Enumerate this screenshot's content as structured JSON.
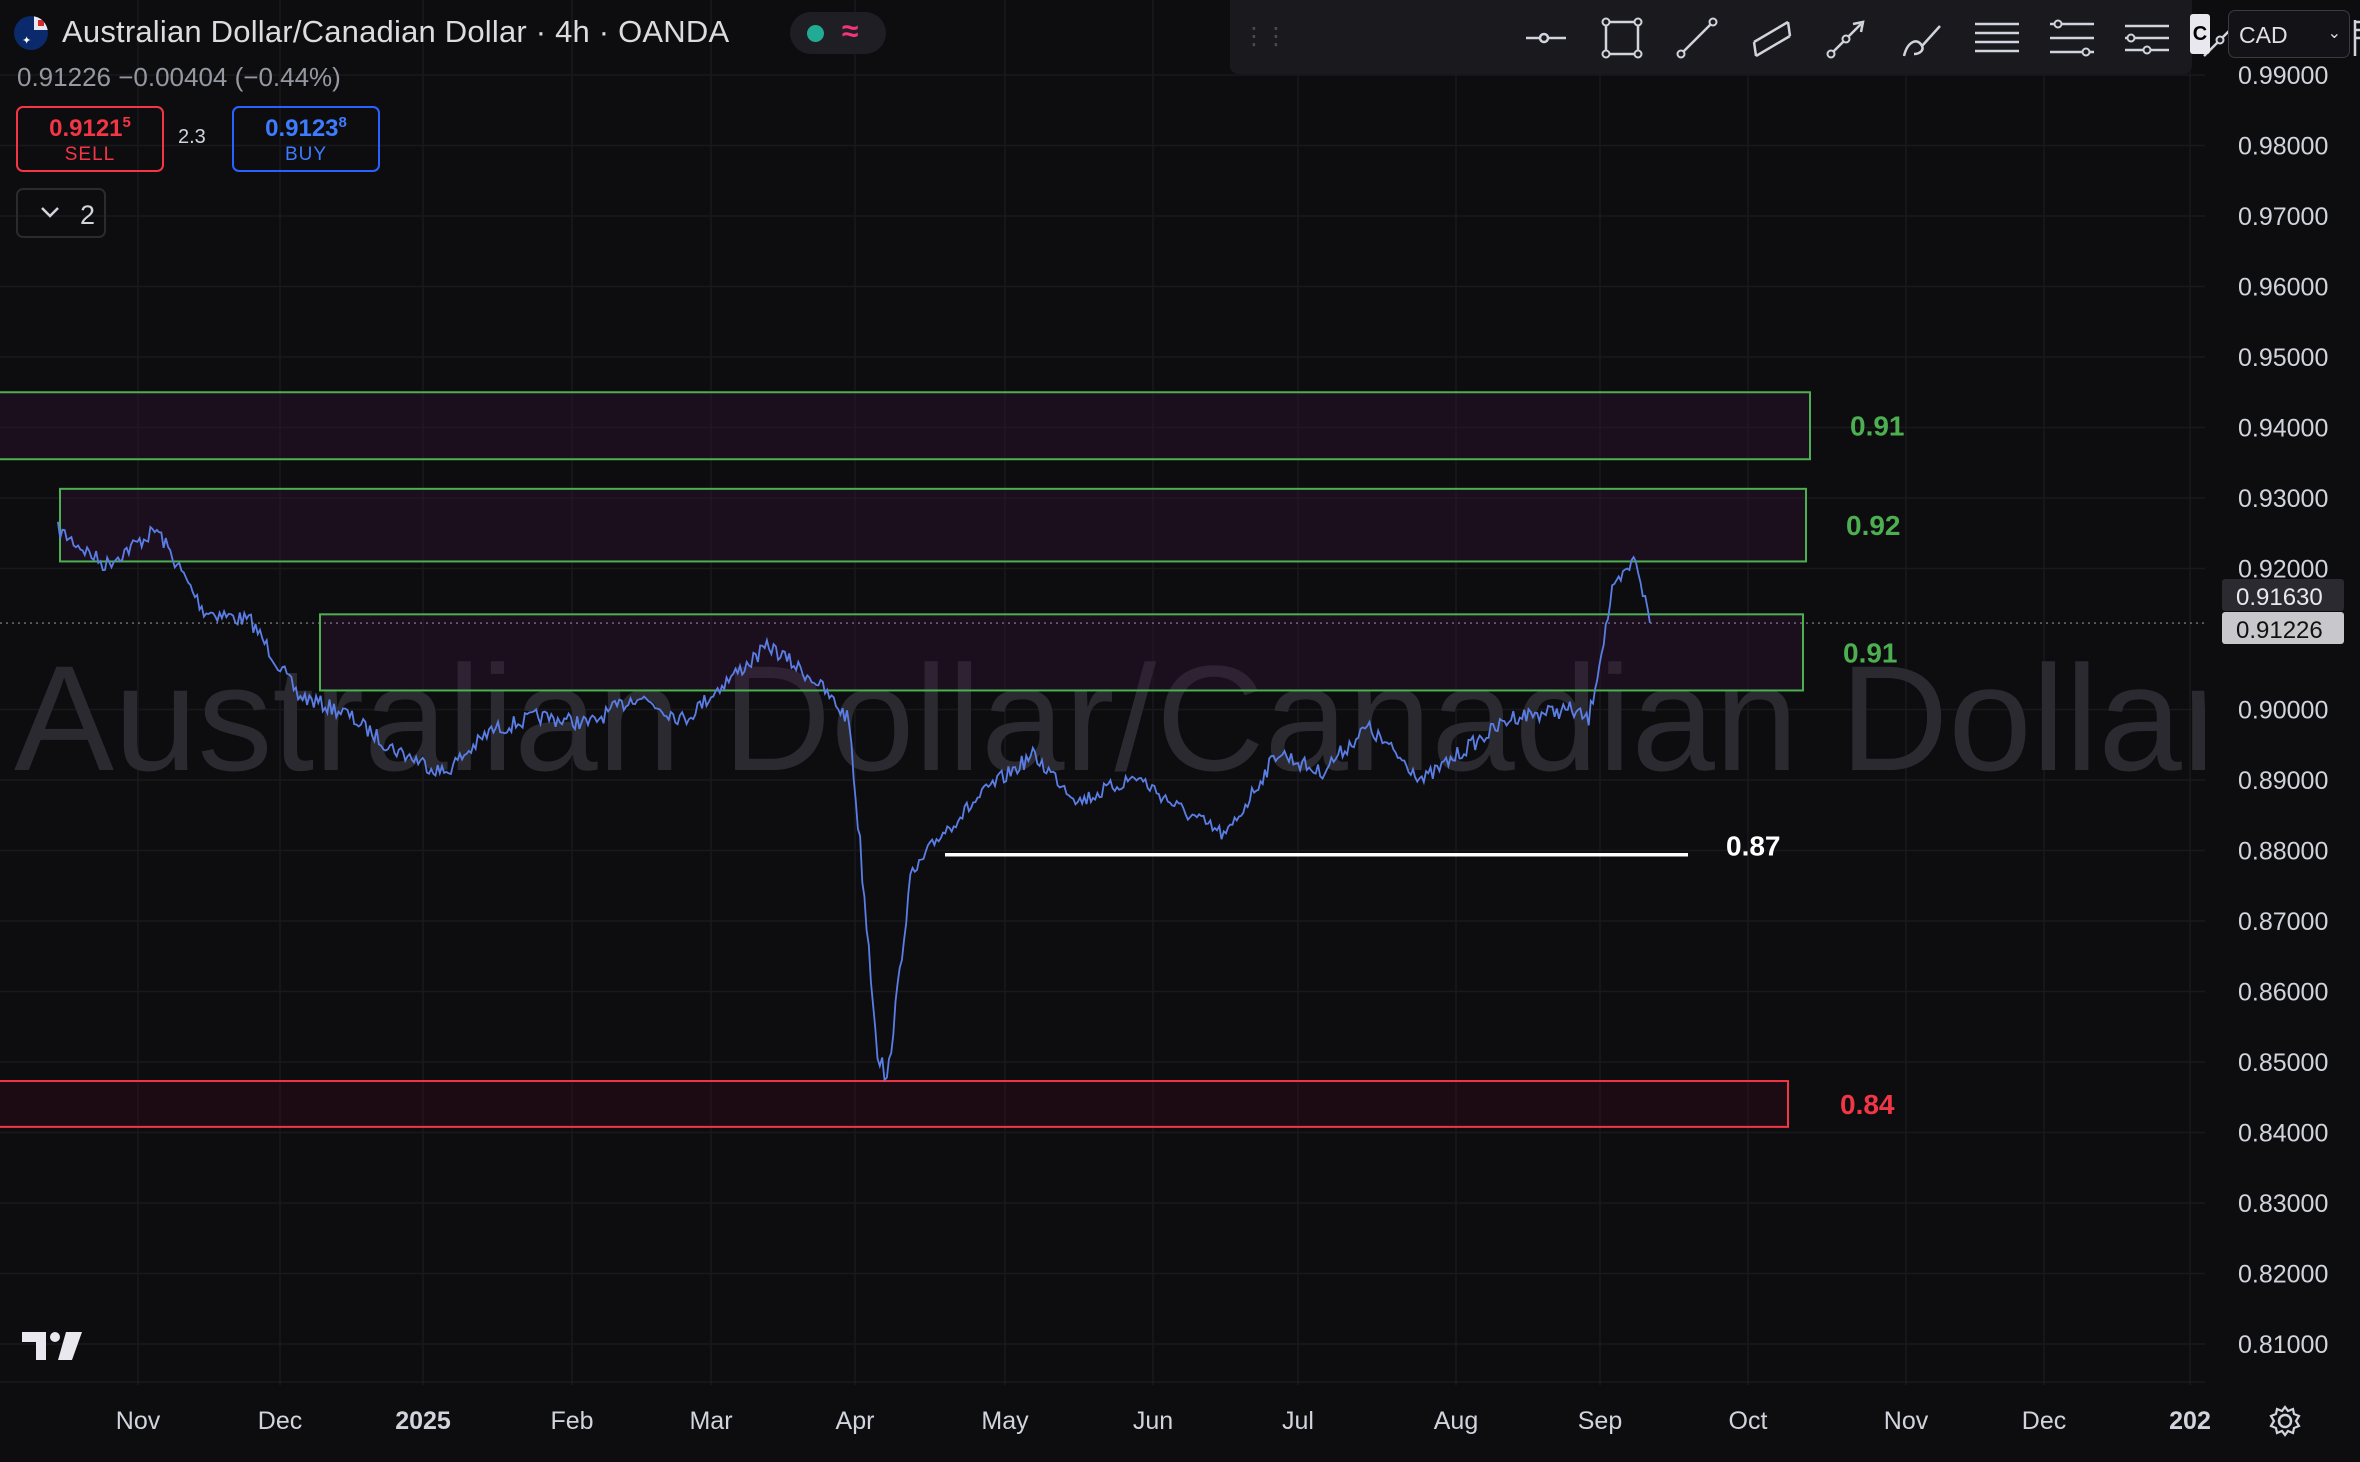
{
  "header": {
    "title": "Australian Dollar/Canadian Dollar · 4h · OANDA",
    "price_line": "0.91226 −0.00404 (−0.44%)"
  },
  "trade": {
    "sell_price": "0.91215",
    "sell_price_main": "0.9121",
    "sell_price_sup": "5",
    "sell_label": "SELL",
    "spread": "2.3",
    "buy_price": "0.91238",
    "buy_price_main": "0.9123",
    "buy_price_sup": "8",
    "buy_label": "BUY"
  },
  "indicator_toggle": {
    "count": "2"
  },
  "watermark": "Australian Dollar/Canadian Dollar",
  "currency_select": {
    "value": "CAD"
  },
  "toolbar": {
    "tools": [
      "horizontal-ray-icon",
      "rectangle-icon",
      "trend-line-icon",
      "parallel-channel-icon",
      "arrow-icon",
      "brush-icon",
      "horizontal-lines-icon",
      "fib-retracement-icon",
      "pitchfork-icon",
      "path-icon",
      "text-icon",
      "flag-icon",
      "pin-icon"
    ]
  },
  "chart_data": {
    "type": "line",
    "symbol": "AUD/CAD",
    "interval": "4h",
    "y_ticks": [
      "0.99000",
      "0.98000",
      "0.97000",
      "0.96000",
      "0.95000",
      "0.94000",
      "0.93000",
      "0.92000",
      "0.90000",
      "0.89000",
      "0.88000",
      "0.87000",
      "0.86000",
      "0.85000",
      "0.84000",
      "0.83000",
      "0.82000",
      "0.81000"
    ],
    "x_ticks": [
      "Nov",
      "Dec",
      "2025",
      "Feb",
      "Mar",
      "Apr",
      "May",
      "Jun",
      "Jul",
      "Aug",
      "Sep",
      "Oct",
      "Nov",
      "Dec",
      "202"
    ],
    "ylim": [
      0.8075,
      0.9935
    ],
    "price_labels": {
      "high_marker": "0.91630",
      "current": "0.91226"
    },
    "series": [
      {
        "color": "#5b7ee6",
        "x": [
          "2024-10-15",
          "2024-10-25",
          "2024-11-05",
          "2024-11-15",
          "2024-11-25",
          "2024-12-05",
          "2024-12-15",
          "2024-12-25",
          "2025-01-05",
          "2025-01-15",
          "2025-01-25",
          "2025-02-05",
          "2025-02-15",
          "2025-02-25",
          "2025-03-05",
          "2025-03-15",
          "2025-03-25",
          "2025-04-01",
          "2025-04-07",
          "2025-04-09",
          "2025-04-14",
          "2025-04-20",
          "2025-05-01",
          "2025-05-10",
          "2025-05-20",
          "2025-06-01",
          "2025-06-10",
          "2025-06-20",
          "2025-07-01",
          "2025-07-10",
          "2025-07-20",
          "2025-08-01",
          "2025-08-10",
          "2025-08-20",
          "2025-09-01",
          "2025-09-05",
          "2025-09-10",
          "2025-09-15",
          "2025-09-18"
        ],
        "values": [
          0.9255,
          0.9205,
          0.9255,
          0.914,
          0.9125,
          0.902,
          0.8995,
          0.8945,
          0.891,
          0.897,
          0.899,
          0.898,
          0.902,
          0.8985,
          0.9035,
          0.909,
          0.904,
          0.8985,
          0.852,
          0.847,
          0.876,
          0.882,
          0.889,
          0.8935,
          0.887,
          0.8905,
          0.886,
          0.882,
          0.894,
          0.891,
          0.8975,
          0.89,
          0.8945,
          0.899,
          0.9,
          0.8985,
          0.9165,
          0.9215,
          0.9123
        ]
      }
    ],
    "zones": [
      {
        "label": "0.91",
        "color": "#4caf50",
        "y_top": 0.945,
        "y_bottom": 0.9355
      },
      {
        "label": "0.92",
        "color": "#4caf50",
        "y_top": 0.9313,
        "y_bottom": 0.921
      },
      {
        "label": "0.91",
        "color": "#4caf50",
        "y_top": 0.9135,
        "y_bottom": 0.9027
      },
      {
        "label": "0.84",
        "color": "#f23645",
        "y_top": 0.8473,
        "y_bottom": 0.8408
      }
    ],
    "support_line": {
      "label": "0.87",
      "color": "#ffffff",
      "y": 0.8794
    }
  }
}
